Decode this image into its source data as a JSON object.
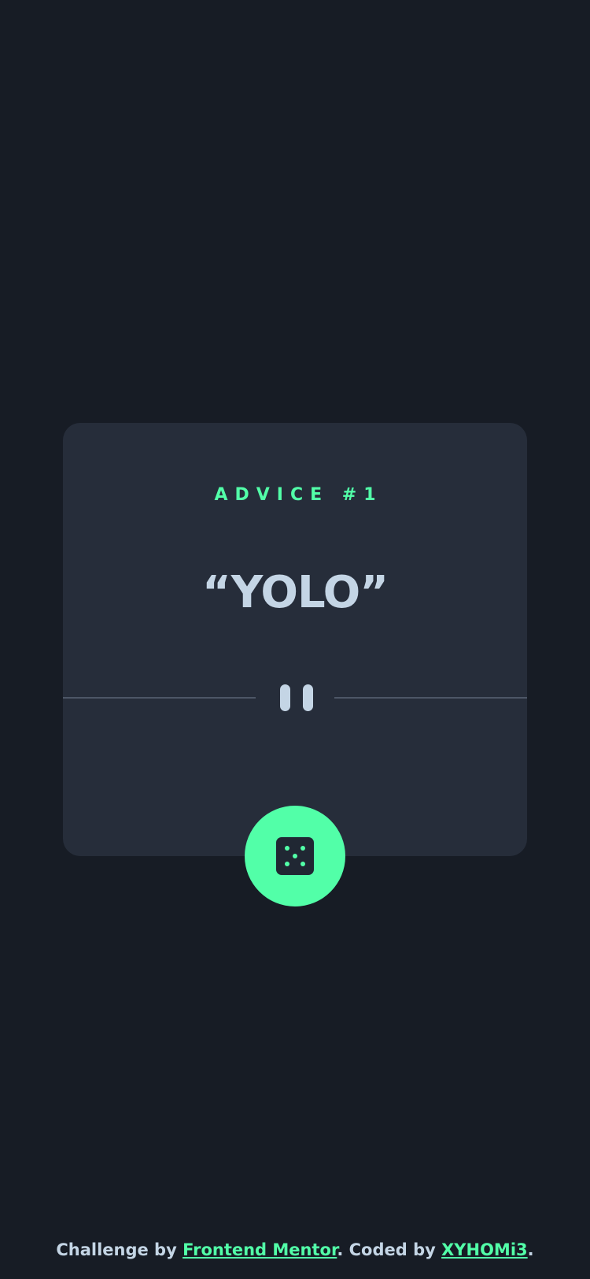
{
  "card": {
    "advice_id": "ADVICE #1",
    "advice_text": "“YOLO”"
  },
  "icons": {
    "divider": "pause-icon",
    "dice": "dice-icon"
  },
  "footer": {
    "prefix": "Challenge by ",
    "link1": "Frontend Mentor",
    "middle": ". Coded by ",
    "link2": "XYHOMi3",
    "suffix": "."
  },
  "colors": {
    "background": "#171c25",
    "card": "#262d3a",
    "accent": "#52ffa8",
    "text": "#c4d5e5"
  }
}
